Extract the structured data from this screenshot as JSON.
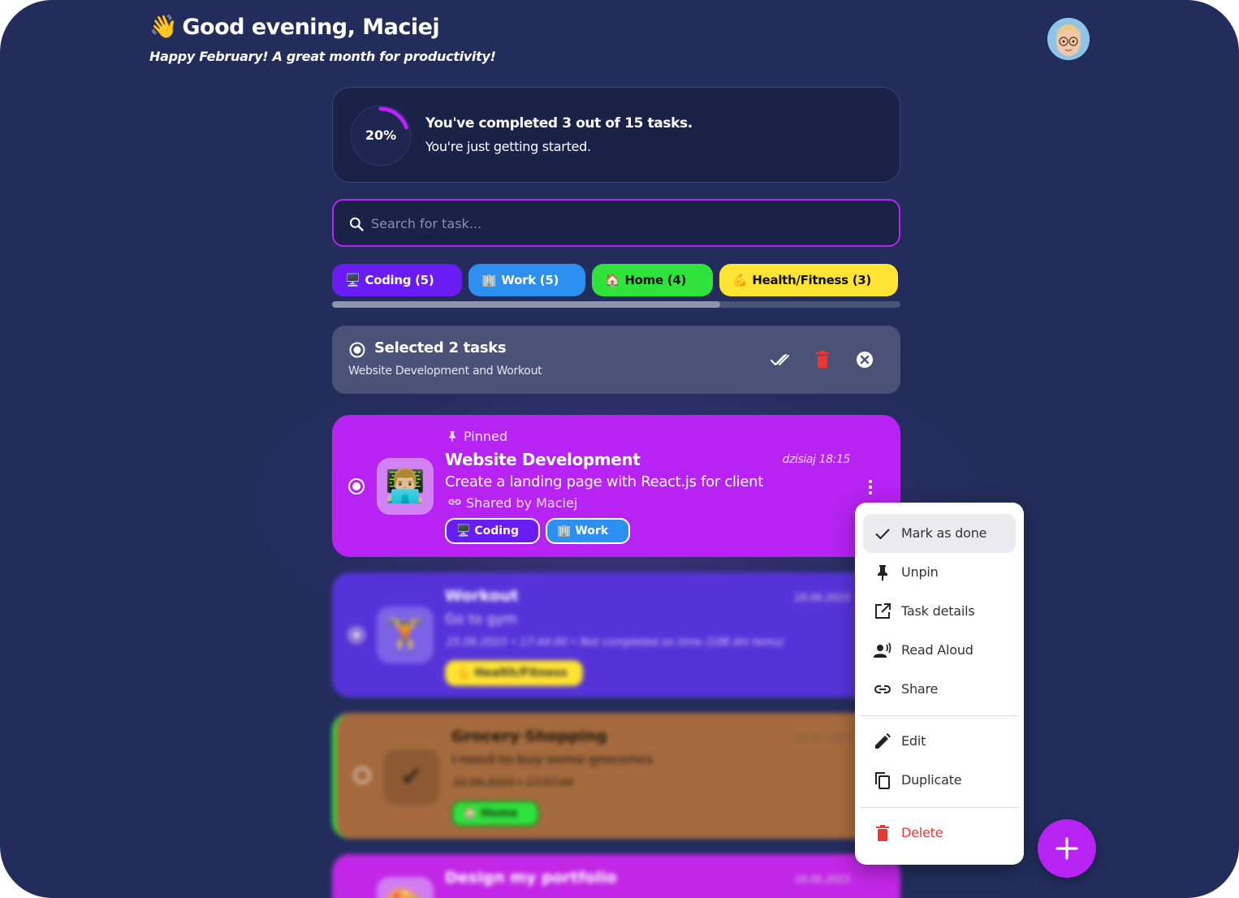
{
  "header": {
    "wave_emoji": "👋",
    "greeting": "Good evening, Maciej",
    "subtitle": "Happy February! A great month for productivity!"
  },
  "progress": {
    "percent_label": "20%",
    "completed_fraction": 0.2,
    "title": "You've completed 3 out of 15 tasks.",
    "subtitle": "You're just getting started."
  },
  "search": {
    "placeholder": "Search for task...",
    "value": ""
  },
  "categories": [
    {
      "emoji": "🖥️",
      "label": "Coding (5)",
      "color": "#6a1cf5",
      "text_color": "#ffffff"
    },
    {
      "emoji": "🏢",
      "label": "Work (5)",
      "color": "#2d8ff0",
      "text_color": "#ffffff"
    },
    {
      "emoji": "🏠",
      "label": "Home (4)",
      "color": "#30e23c",
      "text_color": "#111111"
    },
    {
      "emoji": "💪",
      "label": "Health/Fitness (3)",
      "color": "#ffe433",
      "text_color": "#111111"
    }
  ],
  "selection": {
    "title": "Selected 2 tasks",
    "subtitle": "Website Development and Workout"
  },
  "tasks": [
    {
      "pinned_label": "Pinned",
      "emoji": "👨🏼‍💻",
      "title": "Website Development",
      "date": "dzisiaj 18:15",
      "description": "Create a landing page with React.js for client",
      "shared": "Shared by Maciej",
      "tags": [
        {
          "label": "Coding",
          "emoji": "🖥️",
          "color": "#6a1cf5"
        },
        {
          "label": "Work",
          "emoji": "🏢",
          "color": "#2d8ff0"
        }
      ],
      "color": "#b623f2"
    },
    {
      "emoji": "🏋️",
      "title": "Workout",
      "date": "18.06.2023",
      "description": "Go to gym",
      "meta": "25.06.2023 • 17:44:00 • Not completed on time (188 dni temu)",
      "tags": [
        {
          "label": "Health/Fitness",
          "emoji": "💪",
          "color": "#ffe433"
        }
      ],
      "color": "#5533d8"
    },
    {
      "emoji": "✔",
      "title": "Grocery Shopping",
      "date": "19.06.2023",
      "description": "I need to buy some groceries",
      "meta": "22.06.2023 • 17:57:00",
      "tags": [
        {
          "label": "Home",
          "emoji": "🏠",
          "color": "#30e23c"
        }
      ],
      "color": "#a56b3e"
    },
    {
      "emoji": "🎨",
      "title": "Design my portfolio",
      "date": "19.06.2023",
      "color": "#c226e6"
    }
  ],
  "context_menu": {
    "items": [
      {
        "label": "Mark as done",
        "icon": "check-icon"
      },
      {
        "label": "Unpin",
        "icon": "pin-icon"
      },
      {
        "label": "Task details",
        "icon": "open-in-new-icon"
      },
      {
        "label": "Read Aloud",
        "icon": "record-voice-icon"
      },
      {
        "label": "Share",
        "icon": "link-icon"
      },
      {
        "label": "Edit",
        "icon": "pencil-icon"
      },
      {
        "label": "Duplicate",
        "icon": "copy-icon"
      },
      {
        "label": "Delete",
        "icon": "trash-icon",
        "color": "#e53935"
      }
    ]
  },
  "colors": {
    "background": "#232d5c",
    "accent": "#b623f2",
    "card_dark": "#1b2247",
    "danger": "#e53935"
  }
}
